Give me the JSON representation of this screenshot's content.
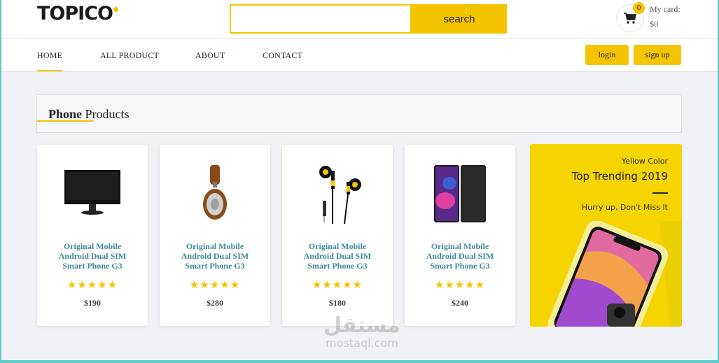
{
  "header": {
    "logo_text": "TOPICO",
    "search": {
      "value": "",
      "placeholder": "",
      "button_label": "search"
    },
    "cart": {
      "count": "0",
      "label": "My card:",
      "total": "$0"
    }
  },
  "nav": {
    "items": [
      {
        "label": "HOME",
        "active": true
      },
      {
        "label": "ALL PRODUCT"
      },
      {
        "label": "ABOUT"
      },
      {
        "label": "CONTACT"
      }
    ],
    "login_label": "login",
    "signup_label": "sign up"
  },
  "section": {
    "title_bold": "Phone",
    "title_rest": " Products"
  },
  "products": [
    {
      "title": "Original Mobile Android Dual SIM Smart Phone G3",
      "price": "$190",
      "rating": 5,
      "image": "monitor"
    },
    {
      "title": "Original Mobile Android Dual SIM Smart Phone G3",
      "price": "$280",
      "rating": 5,
      "image": "headphones"
    },
    {
      "title": "Original Mobile Android Dual SIM Smart Phone G3",
      "price": "$180",
      "rating": 5,
      "image": "earphones"
    },
    {
      "title": "Original Mobile Android Dual SIM Smart Phone G3",
      "price": "$240",
      "rating": 5,
      "image": "smartphone"
    }
  ],
  "banner": {
    "subtitle": "Yellow Color",
    "title": "Top Trending 2019",
    "cta": "Hurry up, Don't Miss It"
  },
  "watermark": {
    "arabic": "مستقل",
    "latin": "mostaql.com"
  },
  "colors": {
    "accent": "#f5c400",
    "product_title": "#3b8c96",
    "frame": "#5ec9c9"
  },
  "icons": {
    "cart": "cart-icon",
    "star": "star-icon"
  }
}
